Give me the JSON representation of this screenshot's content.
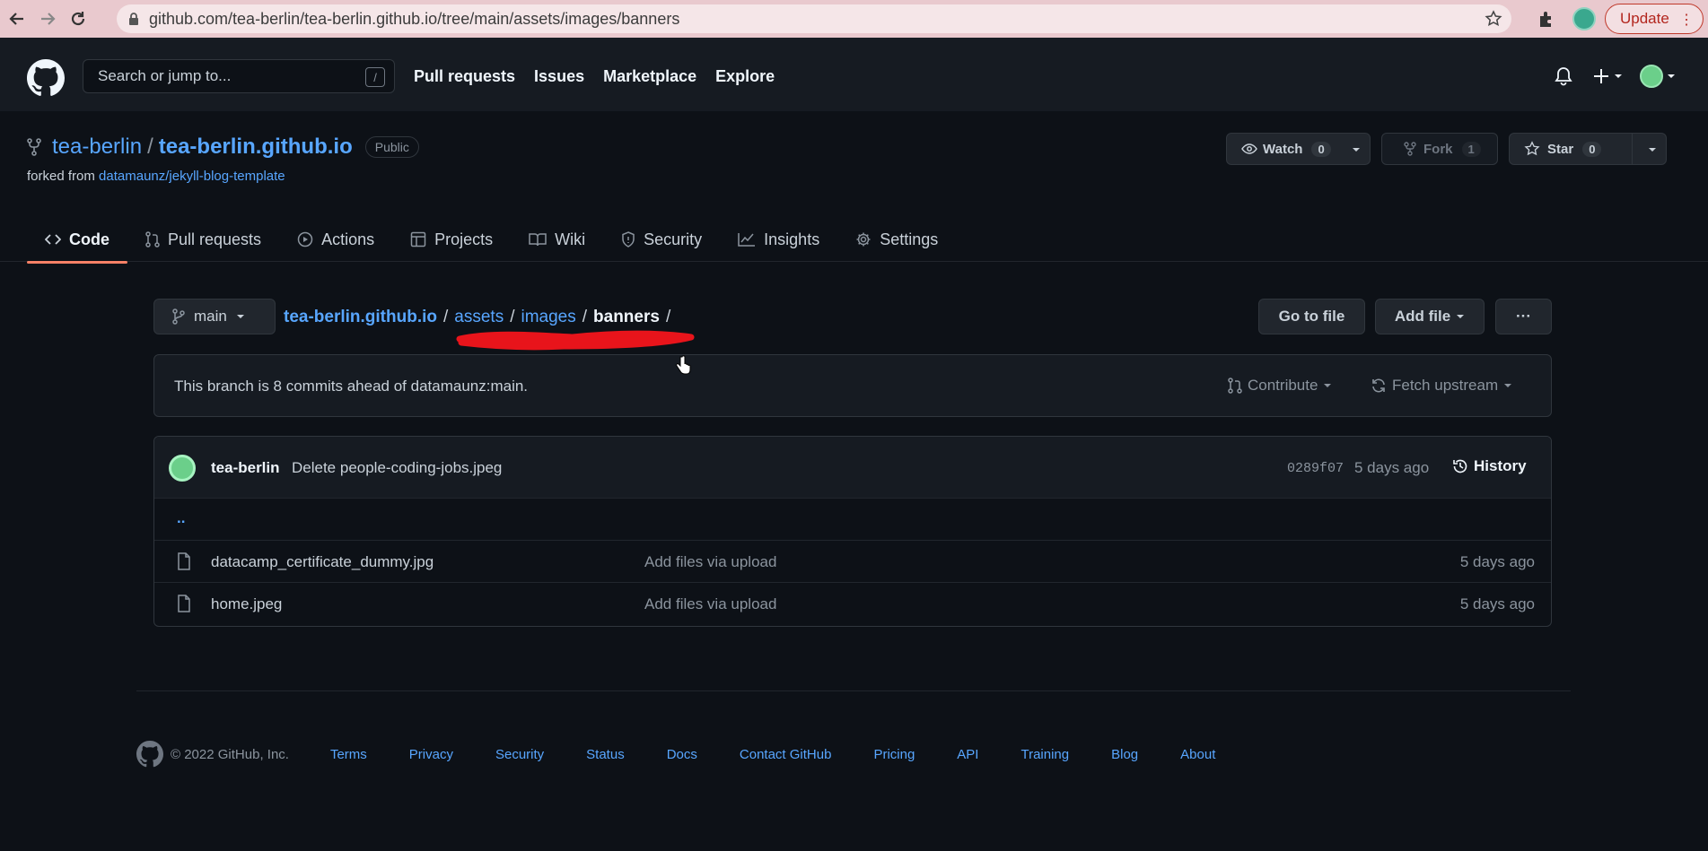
{
  "browser": {
    "url": "github.com/tea-berlin/tea-berlin.github.io/tree/main/assets/images/banners",
    "update_label": "Update"
  },
  "header": {
    "search_placeholder": "Search or jump to...",
    "search_shortcut": "/",
    "nav": [
      "Pull requests",
      "Issues",
      "Marketplace",
      "Explore"
    ]
  },
  "repo": {
    "owner": "tea-berlin",
    "separator": "/",
    "name": "tea-berlin.github.io",
    "visibility": "Public",
    "forked_prefix": "forked from",
    "forked_from": "datamaunz/jekyll-blog-template",
    "watch": {
      "label": "Watch",
      "count": "0"
    },
    "fork": {
      "label": "Fork",
      "count": "1"
    },
    "star": {
      "label": "Star",
      "count": "0"
    }
  },
  "tabs": [
    {
      "label": "Code",
      "icon": "code-icon",
      "active": true
    },
    {
      "label": "Pull requests",
      "icon": "pull-request-icon"
    },
    {
      "label": "Actions",
      "icon": "play-icon"
    },
    {
      "label": "Projects",
      "icon": "table-icon"
    },
    {
      "label": "Wiki",
      "icon": "book-icon"
    },
    {
      "label": "Security",
      "icon": "shield-icon"
    },
    {
      "label": "Insights",
      "icon": "graph-icon"
    },
    {
      "label": "Settings",
      "icon": "gear-icon"
    }
  ],
  "path": {
    "branch": "main",
    "root": "tea-berlin.github.io",
    "segments": [
      "assets",
      "images"
    ],
    "current": "banners",
    "sep": "/",
    "goto_label": "Go to file",
    "add_label": "Add file",
    "more_label": "···"
  },
  "ahead": {
    "message": "This branch is 8 commits ahead of datamaunz:main.",
    "contribute": "Contribute",
    "fetch": "Fetch upstream"
  },
  "commit": {
    "author": "tea-berlin",
    "message": "Delete people-coding-jobs.jpeg",
    "sha": "0289f07",
    "when": "5 days ago",
    "history": "History"
  },
  "files": {
    "parent": "..",
    "items": [
      {
        "name": "datacamp_certificate_dummy.jpg",
        "message": "Add files via upload",
        "age": "5 days ago"
      },
      {
        "name": "home.jpeg",
        "message": "Add files via upload",
        "age": "5 days ago"
      }
    ]
  },
  "footer": {
    "copyright": "© 2022 GitHub, Inc.",
    "links": [
      "Terms",
      "Privacy",
      "Security",
      "Status",
      "Docs",
      "Contact GitHub",
      "Pricing",
      "API",
      "Training",
      "Blog",
      "About"
    ]
  },
  "colors": {
    "accent_link": "#58a6ff",
    "tab_underline": "#f78166",
    "annotation": "#e8141b"
  }
}
